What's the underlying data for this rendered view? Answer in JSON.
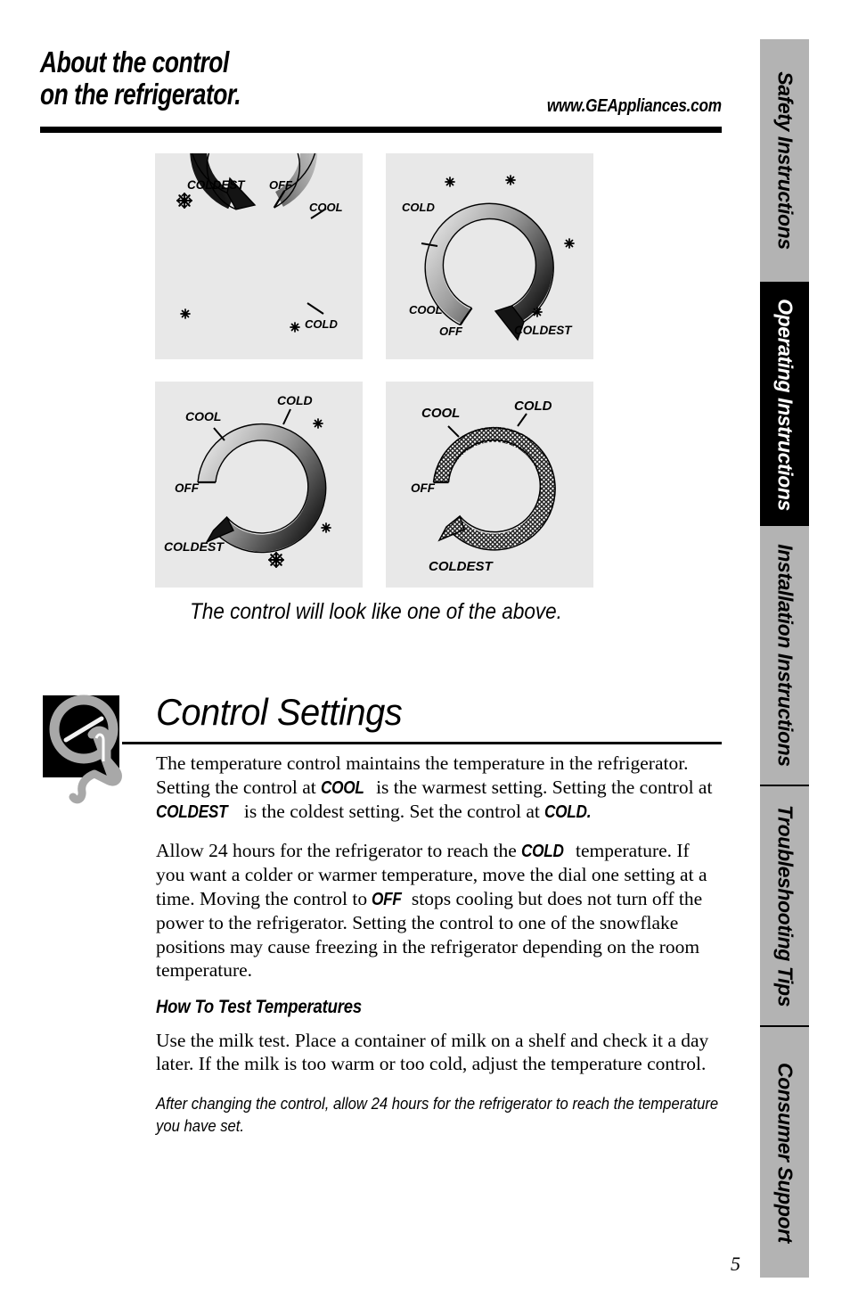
{
  "header": {
    "title_line1": "About the control",
    "title_line2": "on the refrigerator.",
    "url": "www.GEAppliances.com"
  },
  "dials": {
    "caption": "The control will look like one of the above.",
    "panels": [
      {
        "id": "dial-1",
        "labels": {
          "off": "OFF",
          "cool": "COOL",
          "cold": "COLD",
          "coldest": "COLDEST"
        },
        "start_label": "OFF",
        "end_label": "COLDEST",
        "snowflakes": 3,
        "description": "Arc sweeps clockwise from OFF at top-right down through COOL and COLD to COLDEST at top-left, shading light to dark."
      },
      {
        "id": "dial-2",
        "labels": {
          "off": "OFF",
          "cool": "COOL",
          "cold": "COLD",
          "coldest": "COLDEST"
        },
        "start_label": "OFF",
        "end_label": "COLDEST",
        "snowflakes": 4,
        "description": "Mirrored arc sweeps clockwise from OFF at bottom-left up over the top to COLDEST at bottom-right, shading light to dark."
      },
      {
        "id": "dial-3",
        "labels": {
          "off": "OFF",
          "cool": "COOL",
          "cold": "COLD",
          "coldest": "COLDEST"
        },
        "start_label": "OFF",
        "end_label": "COLDEST",
        "snowflakes": 3,
        "description": "Arc sweeps clockwise from OFF at left over the top through COOL and COLD down the right side to COLDEST at bottom-left."
      },
      {
        "id": "dial-4",
        "labels": {
          "off": "OFF",
          "cool": "COOL",
          "cold": "COLD",
          "coldest": "COLDEST"
        },
        "start_label": "OFF",
        "end_label": "COLDEST",
        "snowflakes": 0,
        "description": "Tapered arc sweeps clockwise from OFF at left over the top through COOL and COLD down to COLDEST at bottom, no snowflake markers."
      }
    ]
  },
  "control_settings": {
    "title": "Control Settings",
    "icon": "knob-hand-icon",
    "paragraph_1": {
      "s1": "The temperature control maintains the temperature in the refrigerator. Setting the control at ",
      "kw1": "COOL",
      "s2": " is the warmest setting. Setting the control at ",
      "kw2": "COLDEST",
      "s3": " is the coldest setting. Set the control at ",
      "kw3": "COLD.",
      "s4": ""
    },
    "paragraph_2": {
      "s1": "Allow 24 hours for the refrigerator to reach the ",
      "kw1": "COLD",
      "s2": " temperature. If you want a colder or warmer temperature, move the dial one setting at a time. Moving the control to ",
      "kw2": "OFF",
      "s3": " stops cooling but does not turn off the power to the refrigerator. Setting the control to one of the snowflake positions may cause freezing in the refrigerator depending on the room temperature."
    },
    "subhead": "How To Test Temperatures",
    "paragraph_3": "Use the milk test. Place a container of milk on a shelf and check it a day later. If the milk is too warm or too cold, adjust the temperature control.",
    "note": "After changing the control, allow 24 hours for the refrigerator to reach the temperature you have set."
  },
  "tabs": [
    {
      "label": "Safety Instructions",
      "active": false
    },
    {
      "label": "Operating Instructions",
      "active": true
    },
    {
      "label": "Installation Instructions",
      "active": false
    },
    {
      "label": "Troubleshooting Tips",
      "active": false
    },
    {
      "label": "Consumer Support",
      "active": false
    }
  ],
  "page_number": "5",
  "colors": {
    "panel_background": "#e8e8e8",
    "tab_inactive": "#b3b3b3",
    "tab_active": "#000000",
    "icon_gray": "#a8a8a8",
    "text": "#000000"
  }
}
